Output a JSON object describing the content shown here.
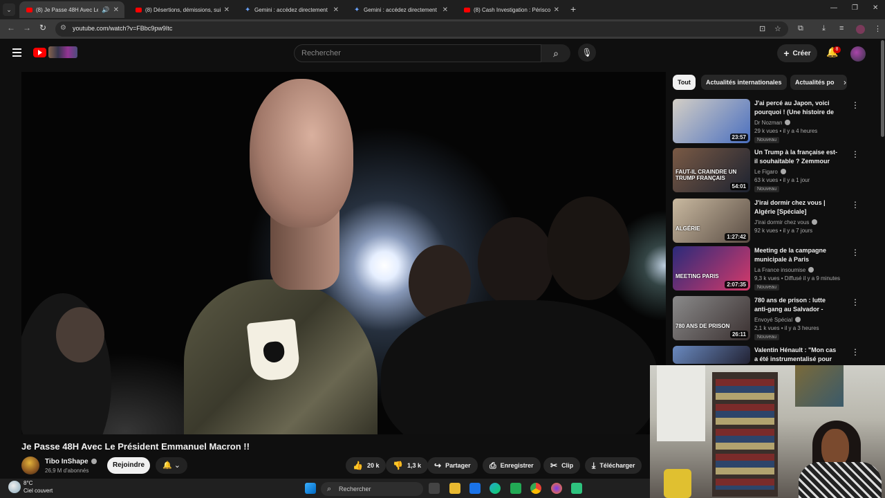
{
  "browser": {
    "tabs": [
      {
        "label": "(8) Je Passe 48H Avec Le Pr",
        "favicon": "youtube",
        "active": true
      },
      {
        "label": "(8) Désertions, démissions, suic",
        "favicon": "youtube",
        "active": false
      },
      {
        "label": "Gemini : accédez directement",
        "favicon": "gemini",
        "active": false
      },
      {
        "label": "Gemini : accédez directement",
        "favicon": "gemini",
        "active": false
      },
      {
        "label": "(8) Cash Investigation : Périscol",
        "favicon": "youtube",
        "active": false
      }
    ],
    "url": "youtube.com/watch?v=FBbc9pw9Itc"
  },
  "youtube": {
    "search_placeholder": "Rechercher",
    "create_label": "Créer",
    "notification_count": "8"
  },
  "video": {
    "title": "Je Passe 48H Avec Le Président Emmanuel Macron !!",
    "watermark": "TI",
    "channel": {
      "name": "Tibo InShape",
      "subscribers": "26,9 M d'abonnés"
    },
    "join_label": "Rejoindre",
    "actions": {
      "likes": "20 k",
      "dislikes": "1,3 k",
      "share": "Partager",
      "save": "Enregistrer",
      "clip": "Clip",
      "download": "Télécharger"
    }
  },
  "chips": [
    "Tout",
    "Actualités internationales",
    "Actualités po"
  ],
  "recommendations": [
    {
      "title": "J'ai percé au Japon, voici pourquoi ! (Une histoire de ...",
      "channel": "Dr Nozman",
      "meta": "29 k vues • il y a 4 heures",
      "duration": "23:57",
      "badge": "Nouveau",
      "thumb_colors": [
        "#d4cfc6",
        "#4a6fbf"
      ]
    },
    {
      "title": "Un Trump à la française est-il souhaitable ? Zemmour face à...",
      "channel": "Le Figaro",
      "meta": "63 k vues • il y a 1 jour",
      "duration": "54:01",
      "badge": "Nouveau",
      "thumb_colors": [
        "#7a5a45",
        "#1c2230"
      ],
      "overlay": "FAUT-IL CRAINDRE UN TRUMP FRANÇAIS"
    },
    {
      "title": "J'irai dormir chez vous | Algérie [Spéciale]",
      "channel": "J'irai dormir chez vous",
      "meta": "92 k vues • il y a 7 jours",
      "duration": "1:27:42",
      "badge": "",
      "thumb_colors": [
        "#c9b9a0",
        "#5a4d44"
      ],
      "overlay": "ALGÉRIE"
    },
    {
      "title": "Meeting de la campagne municipale à Paris",
      "channel": "La France insoumise",
      "meta": "9,3 k vues • Diffusé il y a 9 minutes",
      "duration": "2:07:35",
      "badge": "Nouveau",
      "thumb_colors": [
        "#2a2a7a",
        "#d63a6a"
      ],
      "overlay": "MEETING PARIS"
    },
    {
      "title": "780 ans de prison : lutte anti-gang au Salvador - reportage ...",
      "channel": "Envoyé Spécial",
      "meta": "2,1 k vues • il y a 3 heures",
      "duration": "26:11",
      "badge": "Nouveau",
      "thumb_colors": [
        "#8a8a8a",
        "#3a3030"
      ],
      "overlay": "780 ANS DE PRISON"
    },
    {
      "title": "Valentin Hénault : \"Mon cas a été instrumentalisé pour jeter l...",
      "channel": "",
      "meta": "",
      "duration": "",
      "badge": "",
      "thumb_colors": [
        "#6a8ac0",
        "#223"
      ]
    }
  ],
  "taskbar": {
    "temperature": "8°C",
    "condition": "Ciel couvert",
    "search_label": "Rechercher"
  }
}
